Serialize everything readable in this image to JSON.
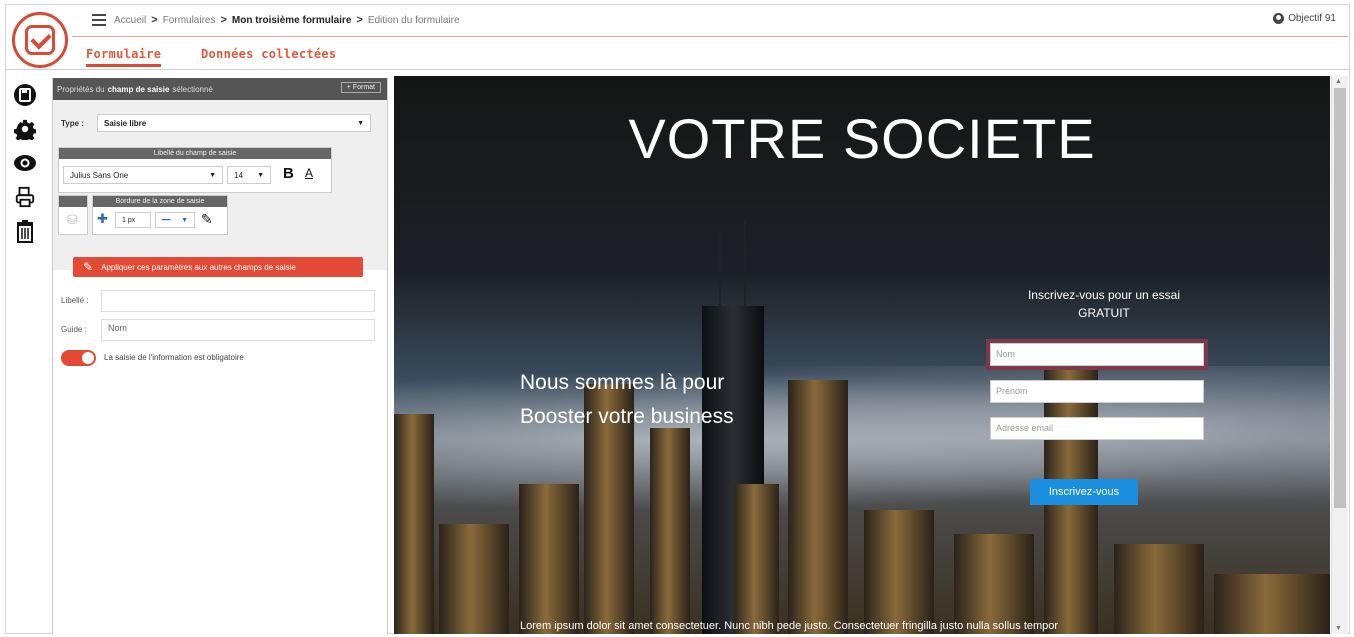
{
  "header": {
    "breadcrumb": [
      "Accueil",
      "Formulaires",
      "Mon troisième formulaire",
      "Edition du formulaire"
    ],
    "user": "Objectif 91"
  },
  "tabs": [
    {
      "label": "Formulaire",
      "active": true
    },
    {
      "label": "Données collectées",
      "active": false
    }
  ],
  "toolbar": {
    "icons": [
      "save-icon",
      "gear-icon",
      "eye-icon",
      "print-icon",
      "trash-icon"
    ]
  },
  "props": {
    "header_pre": "Propriétés du",
    "header_bold": "champ de saisie",
    "header_post": "sélectionné",
    "format_button": "+ Format",
    "type_label": "Type :",
    "type_value": "Saisie libre",
    "label_group_title": "Libellé du champ de saisie",
    "font_family": "Julius Sans One",
    "font_size": "14",
    "bold_label": "B",
    "color_label": "A",
    "border_group_title": "Bordure de la zone de saisie",
    "border_width": "1 px",
    "apply_button": "Appliquer ces paramètres aux autres champs de saisie",
    "libelle_label": "Libellé :",
    "libelle_value": "",
    "guide_label": "Guide :",
    "guide_value": "Nom",
    "required_label": "La saisie de l'information est obligatoire"
  },
  "preview": {
    "title": "VOTRE SOCIETE",
    "slogan_line1": "Nous sommes là pour",
    "slogan_line2": "Booster votre business",
    "cta_line1": "Inscrivez-vous pour un essai",
    "cta_line2": "GRATUIT",
    "field_nom": "Nom",
    "field_prenom": "Prénom",
    "field_email": "Adresse email",
    "submit": "Inscrivez-vous",
    "footer_text": "Lorem ipsum dolor sit amet consectetuer. Nunc nibh pede justo. Consectetuer fringilla justo nulla sollus tempor"
  },
  "colors": {
    "accent": "#e34a35",
    "submit": "#1a8fe0"
  }
}
